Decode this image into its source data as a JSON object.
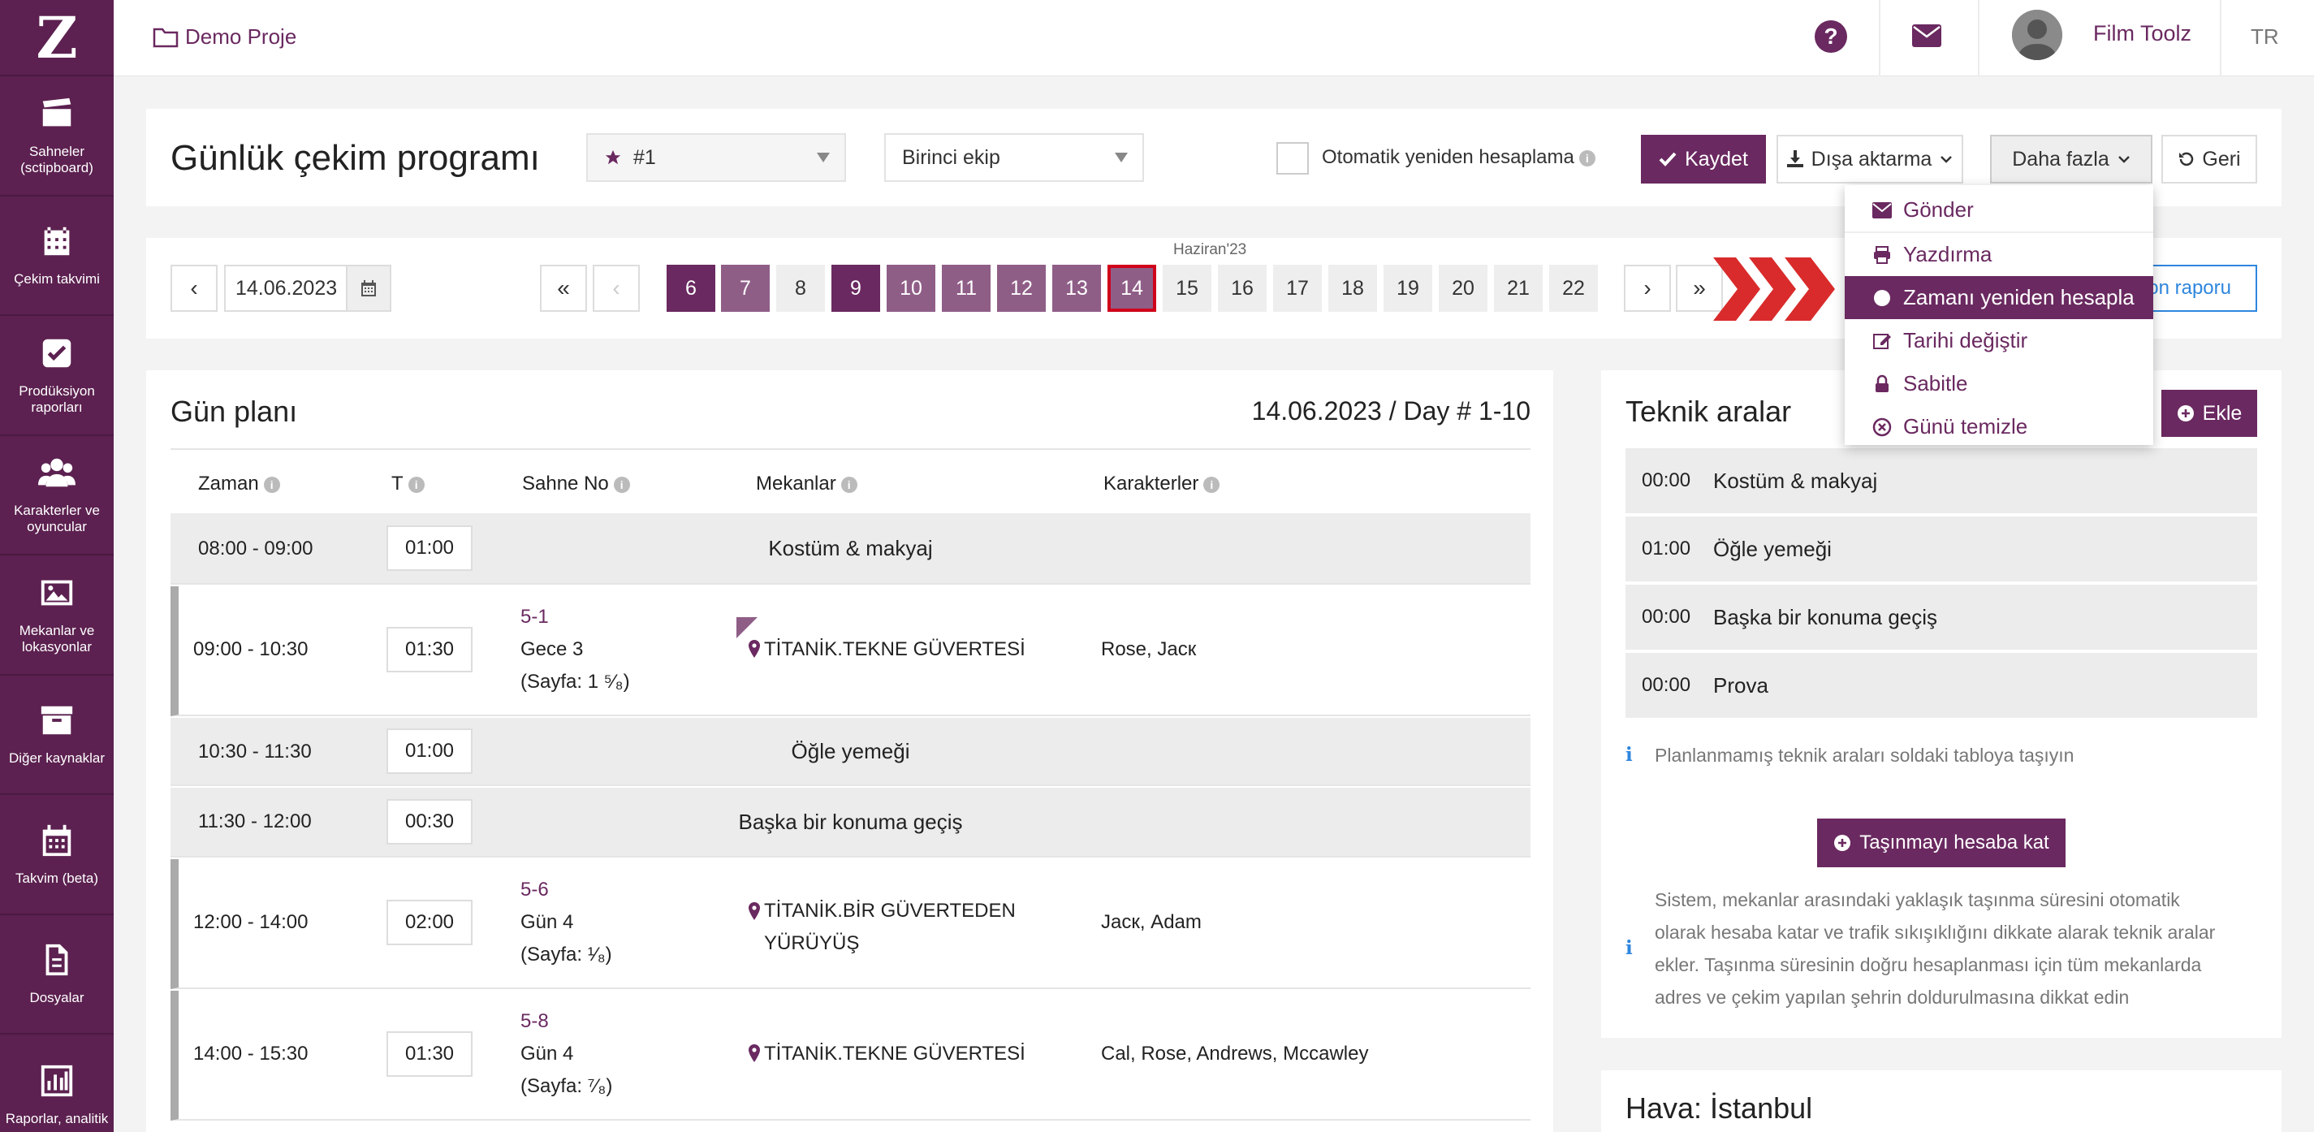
{
  "sidebar": {
    "logo": "Z",
    "items": [
      {
        "label": "Sahneler (sctipboard)",
        "icon": "clapperboard-icon"
      },
      {
        "label": "Çekim takvimi",
        "icon": "calendar-icon"
      },
      {
        "label": "Prodüksiyon raporları",
        "icon": "checkbox-icon"
      },
      {
        "label": "Karakterler ve oyuncular",
        "icon": "users-icon"
      },
      {
        "label": "Mekanlar ve lokasyonlar",
        "icon": "image-icon"
      },
      {
        "label": "Diğer kaynaklar",
        "icon": "archive-icon"
      },
      {
        "label": "Takvim (beta)",
        "icon": "calendar-grid-icon"
      },
      {
        "label": "Dosyalar",
        "icon": "file-icon"
      },
      {
        "label": "Raporlar, analitik",
        "icon": "bar-chart-icon"
      }
    ]
  },
  "topbar": {
    "project": "Demo Proje",
    "help": "?",
    "user_name": "Film Toolz",
    "lang": "TR"
  },
  "header": {
    "title": "Günlük çekim programı",
    "day_select": "#1",
    "crew_select": "Birinci ekip",
    "auto_recalc": "Otomatik yeniden hesaplama",
    "save": "Kaydet",
    "export": "Dışa aktarma",
    "more": "Daha fazla",
    "back": "Geri"
  },
  "strip": {
    "date": "14.06.2023",
    "prev": "‹",
    "first": "«",
    "prev_disabled": "‹",
    "next": "›",
    "last": "»",
    "month": "Haziran'23",
    "days": [
      "6",
      "7",
      "8",
      "9",
      "10",
      "11",
      "12",
      "13",
      "14",
      "15",
      "16",
      "17",
      "18",
      "19",
      "20",
      "21",
      "22"
    ],
    "report": "on raporu"
  },
  "dropdown": {
    "items": [
      "Gönder",
      "Yazdırma",
      "Zamanı yeniden hesapla",
      "Tarihi değiştir",
      "Sabitle",
      "Günü temizle"
    ],
    "active_index": 2
  },
  "plan": {
    "title": "Gün planı",
    "date": "14.06.2023 / Day # 1-10",
    "headers": {
      "time": "Zaman",
      "t": "T",
      "scene": "Sahne No",
      "location": "Mekanlar",
      "characters": "Karakterler"
    },
    "rows": [
      {
        "time": "08:00 - 09:00",
        "t": "01:00",
        "break": "Kostüm & makyaj"
      },
      {
        "time": "09:00 - 10:30",
        "t": "01:30",
        "scene": "5-1",
        "scene_desc": "Gece 3",
        "pages": "(Sayfa: 1 ⁵⁄₈)",
        "location": "TİTANİK.TEKNE GÜVERTESİ",
        "characters": "Rose, Jacк"
      },
      {
        "time": "10:30 - 11:30",
        "t": "01:00",
        "break": "Öğle yemeği"
      },
      {
        "time": "11:30 - 12:00",
        "t": "00:30",
        "break": "Başka bir konuma geçiş"
      },
      {
        "time": "12:00 - 14:00",
        "t": "02:00",
        "scene": "5-6",
        "scene_desc": "Gün 4",
        "pages": "(Sayfa: ¹⁄₈)",
        "location": "TİTANİK.BİR GÜVERTEDEN YÜRÜYÜŞ",
        "characters": "Jacк, Adam"
      },
      {
        "time": "14:00 - 15:30",
        "t": "01:30",
        "scene": "5-8",
        "scene_desc": "Gün 4",
        "pages": "(Sayfa: ⁷⁄₈)",
        "location": "TİTANİK.TEKNE GÜVERTESİ",
        "characters": "Cal, Rose, Andrews, Mccawley"
      }
    ]
  },
  "tech": {
    "title": "Teknik aralar",
    "add": "Ekle",
    "rows": [
      {
        "t": "00:00",
        "label": "Kostüm & makyaj"
      },
      {
        "t": "01:00",
        "label": "Öğle yemeği"
      },
      {
        "t": "00:00",
        "label": "Başka bir konuma geçiş"
      },
      {
        "t": "00:00",
        "label": "Prova"
      }
    ],
    "hint": "Planlanmamış teknik araları soldaki tabloya taşıyın",
    "transport_btn": "Taşınmayı hesaba kat",
    "transport_info": [
      "Sistem, mekanlar arasındaki yaklaşık taşınma süresini otomatik",
      "olarak hesaba katar ve trafik sıkışıklığını dikkate alarak teknik aralar",
      "ekler. Taşınma süresinin doğru hesaplanması için tüm mekanlarda",
      "adres ve çekim yapılan şehrin doldurulmasına dikkat edin"
    ]
  },
  "weather": {
    "title": "Hava: İstanbul"
  },
  "colors": {
    "brand": "#6a2960",
    "brand_dark": "#5c2150",
    "brand_mid": "#8f5e87",
    "arrow_red": "#d92b2b",
    "selected_outline": "#d0021b",
    "link_blue": "#2e86de"
  }
}
